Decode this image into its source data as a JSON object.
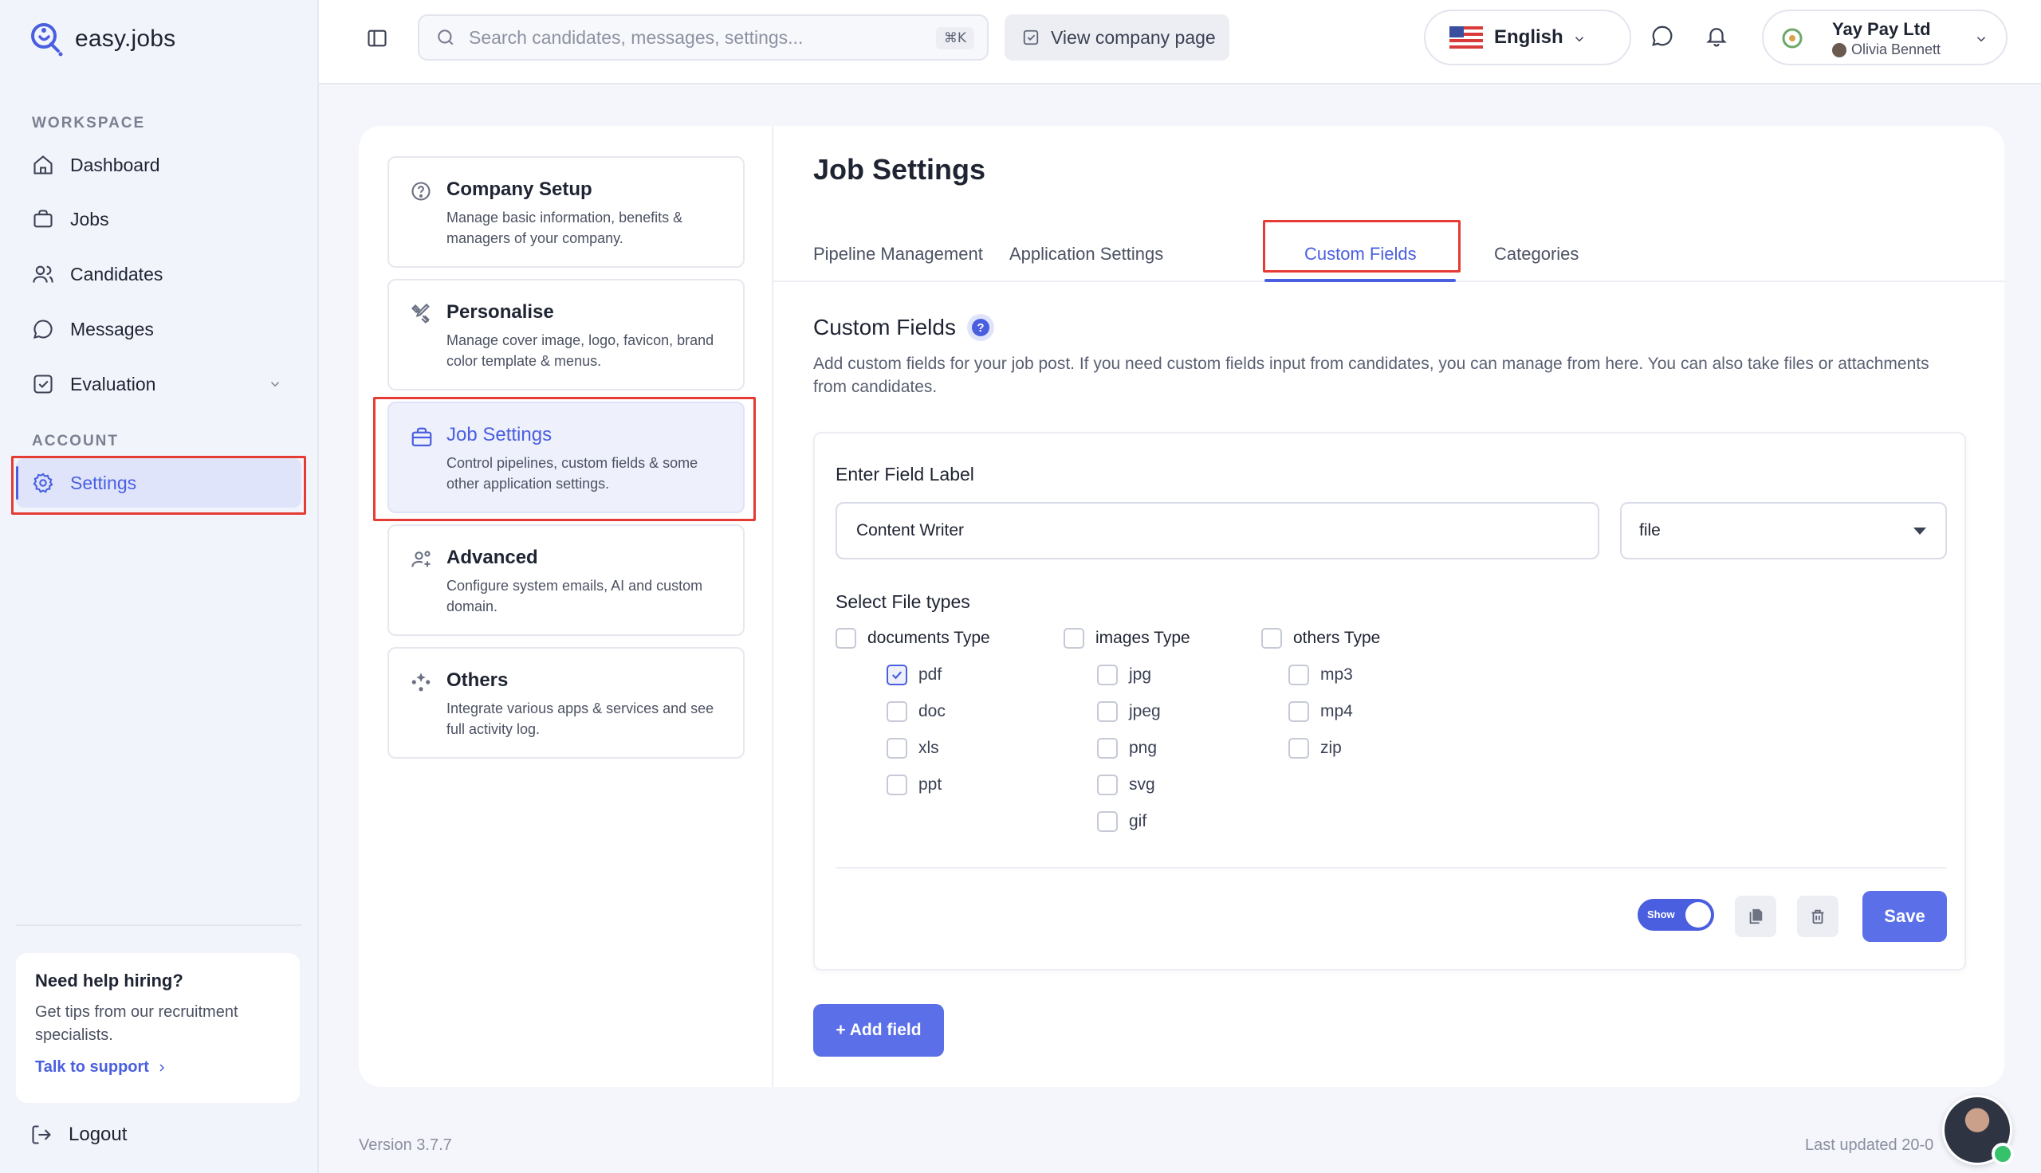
{
  "brand": {
    "name": "easy.jobs"
  },
  "sidebar": {
    "workspace_label": "WORKSPACE",
    "account_label": "ACCOUNT",
    "items": [
      {
        "label": "Dashboard",
        "icon": "home-icon"
      },
      {
        "label": "Jobs",
        "icon": "briefcase-icon"
      },
      {
        "label": "Candidates",
        "icon": "users-icon"
      },
      {
        "label": "Messages",
        "icon": "chat-icon"
      },
      {
        "label": "Evaluation",
        "icon": "checkbox-icon"
      },
      {
        "label": "Settings",
        "icon": "gear-icon"
      }
    ],
    "help": {
      "title": "Need help hiring?",
      "text": "Get tips from our recruitment specialists.",
      "link": "Talk to support"
    },
    "logout": "Logout"
  },
  "topbar": {
    "search_placeholder": "Search candidates, messages, settings...",
    "shortcut": "⌘K",
    "view_company": "View company page",
    "language": "English",
    "company": "Yay Pay Ltd",
    "user": "Olivia Bennett"
  },
  "settings_menu": [
    {
      "title": "Company Setup",
      "desc": "Manage basic information, benefits & managers of your company."
    },
    {
      "title": "Personalise",
      "desc": "Manage cover image, logo, favicon, brand color template & menus."
    },
    {
      "title": "Job Settings",
      "desc": "Control pipelines, custom fields & some other application settings."
    },
    {
      "title": "Advanced",
      "desc": "Configure system emails, AI and custom domain."
    },
    {
      "title": "Others",
      "desc": "Integrate various apps & services and see full activity log."
    }
  ],
  "content": {
    "title": "Job Settings",
    "tabs": [
      "Pipeline Management",
      "Application Settings",
      "Custom Fields",
      "Categories"
    ],
    "active_tab": "Custom Fields",
    "section_title": "Custom Fields",
    "section_desc": "Add custom fields for your job post. If you need custom fields input from candidates, you can manage from here. You can also take files or attachments from candidates.",
    "field": {
      "label_title": "Enter Field Label",
      "label_value": "Content Writer",
      "type_value": "file",
      "file_types_title": "Select File types",
      "groups": [
        {
          "name": "documents Type",
          "items": [
            "pdf",
            "doc",
            "xls",
            "ppt"
          ]
        },
        {
          "name": "images Type",
          "items": [
            "jpg",
            "jpeg",
            "png",
            "svg",
            "gif"
          ]
        },
        {
          "name": "others Type",
          "items": [
            "mp3",
            "mp4",
            "zip"
          ]
        }
      ],
      "checked": [
        "pdf"
      ],
      "toggle_label": "Show",
      "save": "Save"
    },
    "add_field": "+ Add field"
  },
  "footer": {
    "version": "Version 3.7.7",
    "updated": "Last updated 20-0"
  },
  "colors": {
    "accent": "#4a5fe0",
    "highlight": "#e53b35"
  }
}
